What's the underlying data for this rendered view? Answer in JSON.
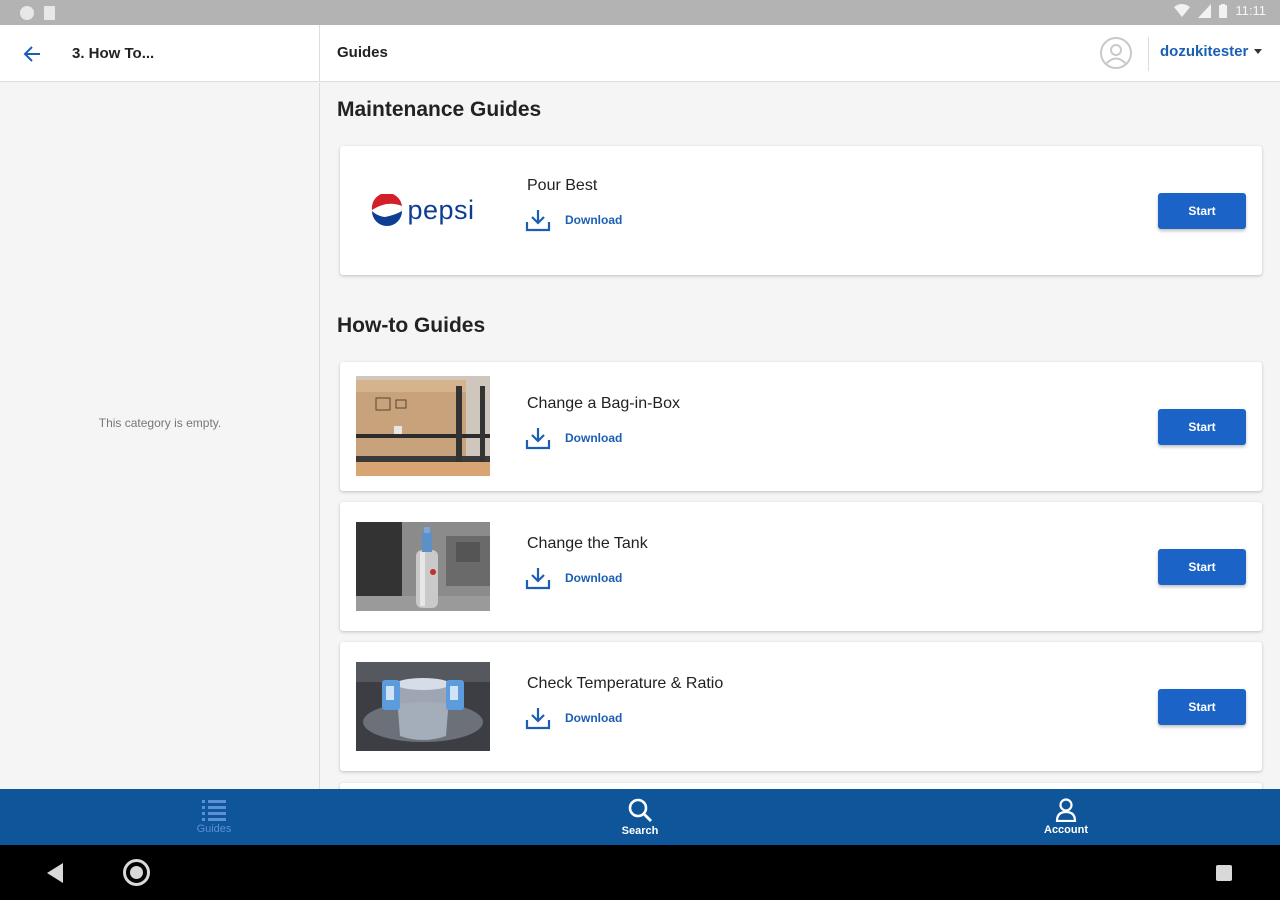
{
  "status_bar": {
    "time": "11:11"
  },
  "header": {
    "back_icon": "arrow-left-icon",
    "breadcrumb": "3. How To...",
    "title": "Guides",
    "user": "dozukitester"
  },
  "left_panel": {
    "empty_message": "This category is empty."
  },
  "sections": {
    "maintenance": {
      "title": "Maintenance Guides",
      "guides": [
        {
          "title": "Pour Best",
          "download": "Download",
          "start": "Start",
          "logo_text": "pepsi"
        }
      ]
    },
    "howto": {
      "title": "How-to Guides",
      "guides": [
        {
          "title": "Change a Bag-in-Box",
          "download": "Download",
          "start": "Start"
        },
        {
          "title": "Change the  Tank",
          "download": "Download",
          "start": "Start"
        },
        {
          "title": "Check Temperature & Ratio",
          "download": "Download",
          "start": "Start"
        }
      ]
    }
  },
  "bottom_nav": {
    "items": [
      {
        "label": "Guides",
        "icon": "list-icon"
      },
      {
        "label": "Search",
        "icon": "search-icon"
      },
      {
        "label": "Account",
        "icon": "account-icon"
      }
    ]
  },
  "colors": {
    "accent": "#1b63c6",
    "nav_bar": "#0e559a",
    "link": "#1b5fb5"
  }
}
